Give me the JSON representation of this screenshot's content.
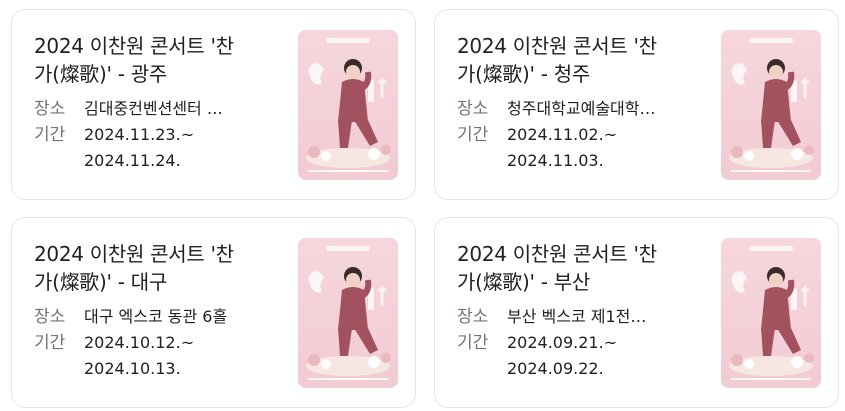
{
  "cards": [
    {
      "title_line1": "2024 이찬원 콘서트 '찬",
      "title_line2": "가(燦歌)' - 광주",
      "venue_label": "장소",
      "venue": "김대중컨벤션센터 …",
      "period_label": "기간",
      "start": "2024.11.23.~",
      "end": "2024.11.24."
    },
    {
      "title_line1": "2024 이찬원 콘서트 '찬",
      "title_line2": "가(燦歌)' - 청주",
      "venue_label": "장소",
      "venue": "청주대학교예술대학…",
      "period_label": "기간",
      "start": "2024.11.02.~",
      "end": "2024.11.03."
    },
    {
      "title_line1": "2024 이찬원 콘서트 '찬",
      "title_line2": "가(燦歌)' - 대구",
      "venue_label": "장소",
      "venue": "대구 엑스코 동관 6홀",
      "period_label": "기간",
      "start": "2024.10.12.~",
      "end": "2024.10.13."
    },
    {
      "title_line1": "2024 이찬원 콘서트 '찬",
      "title_line2": "가(燦歌)' - 부산",
      "venue_label": "장소",
      "venue": "부산 벡스코 제1전…",
      "period_label": "기간",
      "start": "2024.09.21.~",
      "end": "2024.09.22."
    }
  ],
  "colors": {
    "poster_bg": "#f2cbd3",
    "suit": "#a2525f",
    "text_primary": "#202124",
    "text_secondary": "#70757a"
  }
}
